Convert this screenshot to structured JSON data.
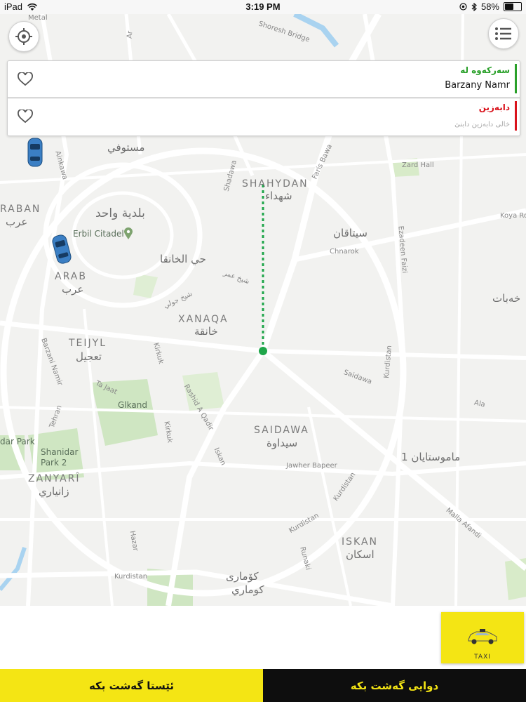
{
  "status_bar": {
    "device": "iPad",
    "time": "3:19 PM",
    "battery_percent": "58%",
    "battery_level": 0.58
  },
  "map": {
    "area_labels": [
      {
        "en": "SHAHYDAN",
        "ar": "شهداء"
      },
      {
        "en": "XANAQA",
        "ar": "خانقة"
      },
      {
        "en": "TEIJYL",
        "ar": "تعجيل"
      },
      {
        "en": "SAIDAWA",
        "ar": "سيداوة"
      },
      {
        "en": "ZANYARÎ",
        "ar": "زانياري"
      },
      {
        "en": "ISKAN",
        "ar": "اسكان"
      },
      {
        "en": "ARAB",
        "ar": "عرب"
      },
      {
        "en": "RABAN",
        "ar": "عرب"
      }
    ],
    "arabic_labels": [
      "بلدية واحد",
      "مستوفي",
      "حي الخانقا",
      "سيتاقان",
      "ماموستايان 1",
      "كۆماری",
      "كوماري",
      "شيخ عمر",
      "شيخ جولي",
      "خەبات"
    ],
    "poi_labels": [
      "Erbil Citadel",
      "Glkand",
      "Shanidar Park 2",
      "dar Park"
    ],
    "street_labels": [
      "Shoresh Bridge",
      "Faris Bawa",
      "Zard Hall",
      "Koya Ro",
      "Chnarok",
      "Ezadeen Faizi",
      "Kurdistan",
      "Ala",
      "Malla Afandi",
      "Jawher Bapeer",
      "Kurdistan",
      "Kurdistan",
      "Kurdistan",
      "Kirkuk",
      "Kirkuk",
      "Barzani Namir",
      "Saidawa",
      "Rashid A Qadir",
      "Iskan",
      "Ta Jaat",
      "Tehran",
      "Shadawa",
      "Ainkawa",
      "Hazar",
      "Runaki",
      "Ar",
      "Metal"
    ]
  },
  "address_panel": {
    "pickup": {
      "title": "سەرکەوە لە",
      "value": "Barzany Namr",
      "color": "#2aa02a"
    },
    "dropoff": {
      "title": "دابەزین",
      "placeholder": "خالی دابەزین دابنێ",
      "color": "#d9131c"
    }
  },
  "taxi_card": {
    "label": "TAXI"
  },
  "bottom_buttons": {
    "ride_now": "ئێستا گەشت بکە",
    "ride_later": "دوایی گەشت بکە"
  },
  "colors": {
    "accent_yellow": "#f4e514",
    "dark": "#0e0e0e",
    "route_green": "#1fa64a",
    "map_bg": "#f2f2f0"
  },
  "icons": [
    "wifi-icon",
    "location-icon",
    "bluetooth-icon",
    "battery-icon",
    "crosshair-icon",
    "menu-list-icon",
    "heart-icon",
    "taxi-car-icon"
  ]
}
